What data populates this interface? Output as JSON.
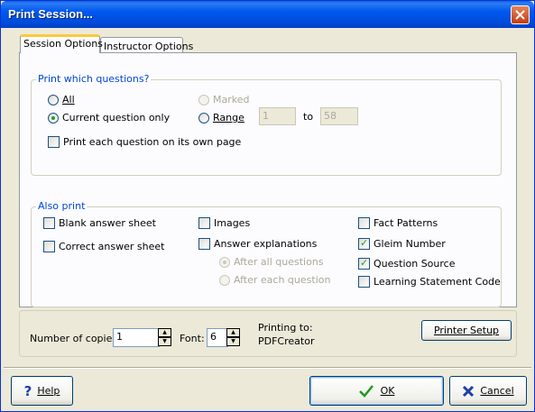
{
  "window": {
    "title": "Print Session..."
  },
  "tabs": [
    {
      "label": "Session Options"
    },
    {
      "label": "Instructor Options"
    }
  ],
  "print_which": {
    "title": "Print which questions?",
    "all": {
      "label": "All",
      "selected": false
    },
    "current_only": {
      "label": "Current question only",
      "selected": true
    },
    "marked": {
      "label": "Marked",
      "selected": false,
      "disabled": true
    },
    "range": {
      "label": "Range",
      "selected": false,
      "from": "1",
      "to_label": "to",
      "to": "58"
    },
    "own_page": {
      "label": "Print each question on its own page",
      "checked": false
    }
  },
  "also_print": {
    "title": "Also print",
    "blank_answer_sheet": {
      "label": "Blank answer sheet",
      "checked": false
    },
    "correct_answer_sheet": {
      "label": "Correct answer sheet",
      "checked": false
    },
    "images": {
      "label": "Images",
      "checked": false
    },
    "answer_explanations": {
      "label": "Answer explanations",
      "checked": false
    },
    "after_all": {
      "label": "After all questions",
      "selected": true,
      "disabled": true
    },
    "after_each": {
      "label": "After each question",
      "selected": false,
      "disabled": true
    },
    "fact_patterns": {
      "label": "Fact Patterns",
      "checked": false
    },
    "gleim_number": {
      "label": "Gleim Number",
      "checked": true
    },
    "question_source": {
      "label": "Question Source",
      "checked": true
    },
    "learning_statement": {
      "label": "Learning Statement Code",
      "checked": false
    }
  },
  "bottom": {
    "copies_label": "Number of copies:",
    "copies_value": "1",
    "font_label": "Font:",
    "font_value": "6",
    "printing_to_label": "Printing to:",
    "printer_name": "PDFCreator",
    "printer_setup": "Printer Setup"
  },
  "buttons": {
    "help": "Help",
    "ok": "OK",
    "cancel": "Cancel"
  },
  "colors": {
    "title_bar": "#0058ee",
    "group_title": "#0046d5",
    "check": "#21a121",
    "dialog": "#ece9d8"
  }
}
